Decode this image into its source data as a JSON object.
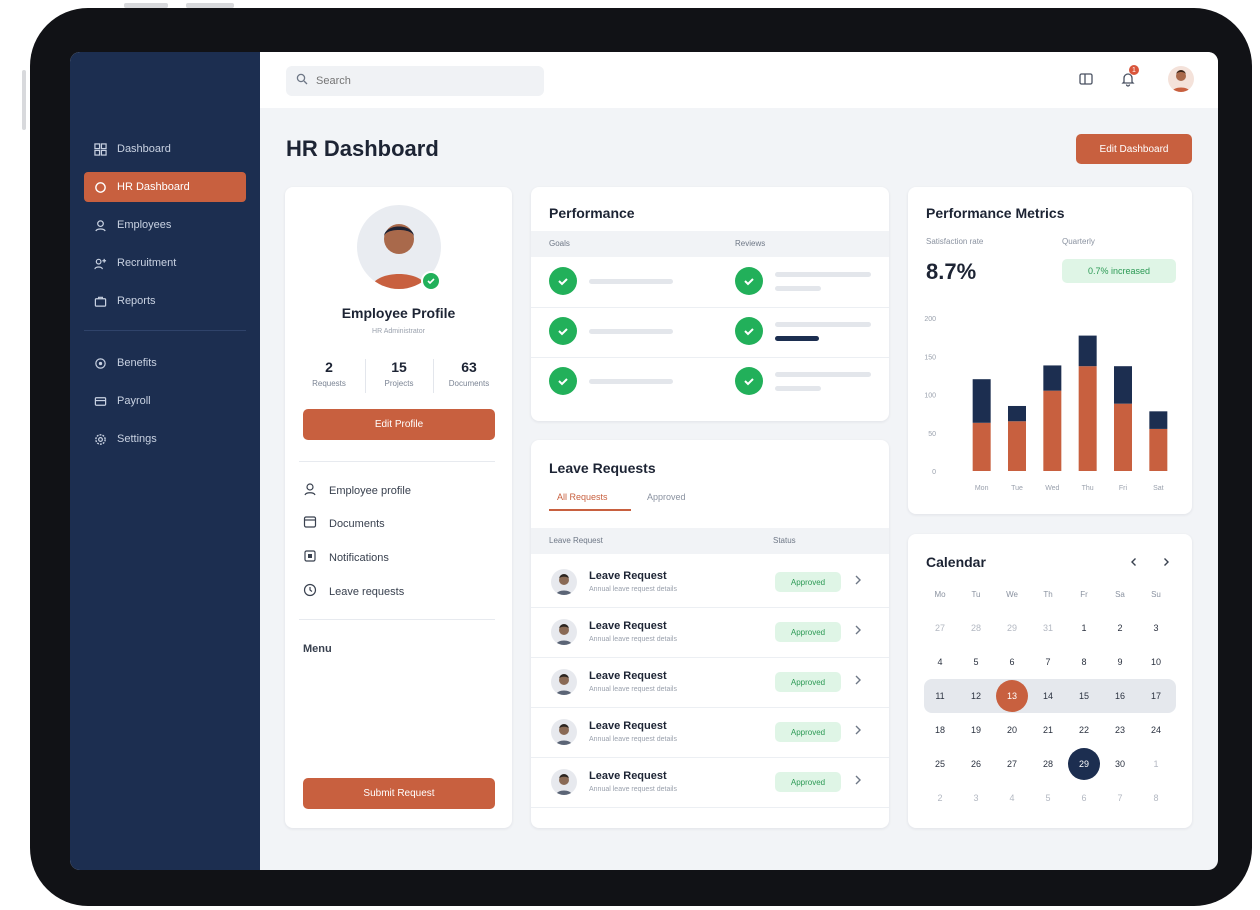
{
  "colors": {
    "sidebar": "#1c2e50",
    "accent": "#c8603f",
    "success": "#22b05a",
    "navy": "#1c2e50"
  },
  "search": {
    "placeholder": "Search"
  },
  "topbar": {
    "notification_count": "1",
    "icons": [
      "layout-icon",
      "bell-icon",
      "avatar"
    ]
  },
  "sidebar": {
    "items": [
      {
        "label": "Dashboard",
        "icon": "grid-icon"
      },
      {
        "label": "HR Dashboard",
        "icon": "circle-icon"
      },
      {
        "label": "Employees",
        "icon": "user-icon"
      },
      {
        "label": "Recruitment",
        "icon": "users-icon"
      },
      {
        "label": "Reports",
        "icon": "briefcase-icon"
      },
      {
        "label": "Benefits",
        "icon": "gear-icon"
      },
      {
        "label": "Payroll",
        "icon": "card-icon"
      },
      {
        "label": "Settings",
        "icon": "settings-icon"
      }
    ]
  },
  "page": {
    "title": "HR Dashboard",
    "action_label": "Edit Dashboard"
  },
  "profile": {
    "name": "Employee Profile",
    "subtitle": "HR Administrator",
    "stats": [
      {
        "value": "2",
        "label": "Requests"
      },
      {
        "value": "15",
        "label": "Projects"
      },
      {
        "value": "63",
        "label": "Documents"
      }
    ],
    "primary_button": "Edit Profile",
    "links": [
      {
        "label": "Employee profile",
        "icon": "user-icon"
      },
      {
        "label": "Documents",
        "icon": "folder-icon"
      },
      {
        "label": "Notifications",
        "icon": "square-icon"
      },
      {
        "label": "Leave requests",
        "icon": "clock-icon"
      }
    ],
    "menu_label": "Menu",
    "bottom_button": "Submit Request"
  },
  "performance": {
    "title": "Performance",
    "columns": [
      "Goals",
      "Reviews"
    ],
    "rows": [
      {
        "left_done": true,
        "right_done": true
      },
      {
        "left_done": true,
        "right_done": true
      },
      {
        "left_done": true,
        "right_done": true
      }
    ]
  },
  "leave": {
    "title": "Leave Requests",
    "tabs": [
      "All Requests",
      "Approved"
    ],
    "active_tab": 0,
    "columns": [
      "Leave Request",
      "Status"
    ],
    "rows": [
      {
        "title": "Leave Request",
        "subtitle": "Annual leave request details",
        "status": "Approved"
      },
      {
        "title": "Leave Request",
        "subtitle": "Annual leave request details",
        "status": "Approved"
      },
      {
        "title": "Leave Request",
        "subtitle": "Annual leave request details",
        "status": "Approved"
      },
      {
        "title": "Leave Request",
        "subtitle": "Annual leave request details",
        "status": "Approved"
      },
      {
        "title": "Leave Request",
        "subtitle": "Annual leave request details",
        "status": "Approved"
      }
    ]
  },
  "metrics": {
    "title": "Performance Metrics",
    "stat_label": "Satisfaction rate",
    "stat_value": "8.7%",
    "trend_label": "Quarterly",
    "trend_badge": "0.7% increased"
  },
  "chart_data": {
    "type": "bar",
    "stacked": true,
    "categories": [
      "Mon",
      "Tue",
      "Wed",
      "Thu",
      "Fri",
      "Sat"
    ],
    "series": [
      {
        "values": [
          63,
          65,
          105,
          137,
          88,
          55
        ],
        "color": "#c8603f"
      },
      {
        "values": [
          57,
          20,
          33,
          40,
          49,
          23
        ],
        "color": "#1c2e50"
      }
    ],
    "y_ticks": [
      0,
      50,
      100,
      150,
      200
    ],
    "ylim": [
      0,
      200
    ]
  },
  "calendar": {
    "title": "Calendar",
    "weekdays": [
      "Mo",
      "Tu",
      "We",
      "Th",
      "Fr",
      "Sa",
      "Su"
    ],
    "weeks": [
      [
        "27",
        "28",
        "29",
        "31",
        "1",
        "2",
        "3"
      ],
      [
        "4",
        "5",
        "6",
        "7",
        "8",
        "9",
        "10"
      ],
      [
        "11",
        "12",
        "13",
        "14",
        "15",
        "16",
        "17"
      ],
      [
        "18",
        "19",
        "20",
        "21",
        "22",
        "23",
        "24"
      ],
      [
        "25",
        "26",
        "27",
        "28",
        "29",
        "30",
        "1"
      ],
      [
        "2",
        "3",
        "4",
        "5",
        "6",
        "7",
        "8"
      ]
    ],
    "dim_cells": [
      "0-0",
      "0-1",
      "0-2",
      "0-3",
      "4-6",
      "5-0",
      "5-1",
      "5-2",
      "5-3",
      "5-4",
      "5-5",
      "5-6"
    ],
    "highlighted_week": 2,
    "accent_cell": "2-2",
    "navy_cell": "4-4"
  }
}
